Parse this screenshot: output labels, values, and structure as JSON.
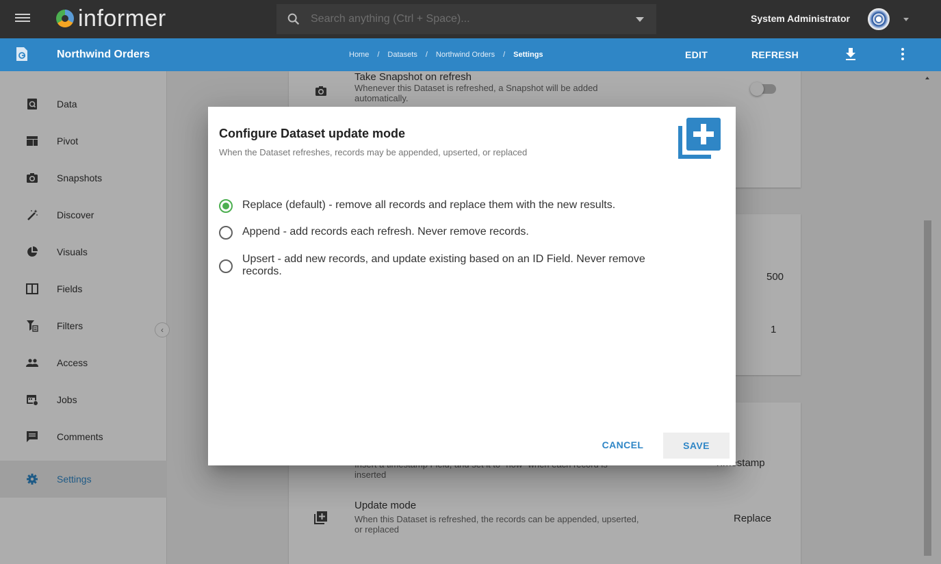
{
  "topbar": {
    "app_name": "informer",
    "search_placeholder": "Search anything (Ctrl + Space)...",
    "user_name": "System Administrator"
  },
  "bluebar": {
    "dataset_title": "Northwind Orders",
    "breadcrumb": [
      "Home",
      "Datasets",
      "Northwind Orders",
      "Settings"
    ],
    "breadcrumb_sep": "/",
    "edit_label": "EDIT",
    "refresh_label": "REFRESH"
  },
  "sidebar": {
    "items": [
      {
        "label": "Data",
        "icon": "search-doc-icon"
      },
      {
        "label": "Pivot",
        "icon": "pivot-table-icon"
      },
      {
        "label": "Snapshots",
        "icon": "camera-icon"
      },
      {
        "label": "Discover",
        "icon": "magic-wand-icon"
      },
      {
        "label": "Visuals",
        "icon": "pie-chart-icon"
      },
      {
        "label": "Fields",
        "icon": "columns-icon"
      },
      {
        "label": "Filters",
        "icon": "filter-icon"
      },
      {
        "label": "Access",
        "icon": "people-icon"
      },
      {
        "label": "Jobs",
        "icon": "calendar-sync-icon"
      },
      {
        "label": "Comments",
        "icon": "comment-icon"
      },
      {
        "label": "Settings",
        "icon": "gear-icon"
      }
    ],
    "active": "Settings",
    "collapse_symbol": "‹"
  },
  "background": {
    "snapshot_setting": {
      "title": "Take Snapshot on refresh",
      "desc_line1": "Whenever this Dataset is refreshed, a Snapshot will be added",
      "desc_line2": "automatically."
    },
    "values": {
      "v1": "500",
      "v2": "1"
    },
    "timestamp_setting": {
      "desc_line1": "Insert a timestamp Field, and set it to \"now\" when each record is",
      "desc_line2": "inserted",
      "value": "Timestamp"
    },
    "update_mode_setting": {
      "title": "Update mode",
      "desc_line1": "When this Dataset is refreshed, the records can be appended, upserted,",
      "desc_line2": "or replaced",
      "value": "Replace"
    }
  },
  "modal": {
    "title": "Configure Dataset update mode",
    "subtitle": "When the Dataset refreshes, records may be appended, upserted, or replaced",
    "options": [
      {
        "label": "Replace (default) - remove all records and replace them with the new results.",
        "checked": true
      },
      {
        "label": "Append - add records each refresh. Never remove records.",
        "checked": false
      },
      {
        "label_line1": "Upsert - add new records, and update existing based on an ID Field. Never remove",
        "label_line2": "records.",
        "checked": false
      }
    ],
    "cancel_label": "CANCEL",
    "save_label": "SAVE"
  },
  "colors": {
    "topbar": "#303030",
    "accent_blue": "#2f86c6",
    "radio_checked": "#4caf50"
  }
}
